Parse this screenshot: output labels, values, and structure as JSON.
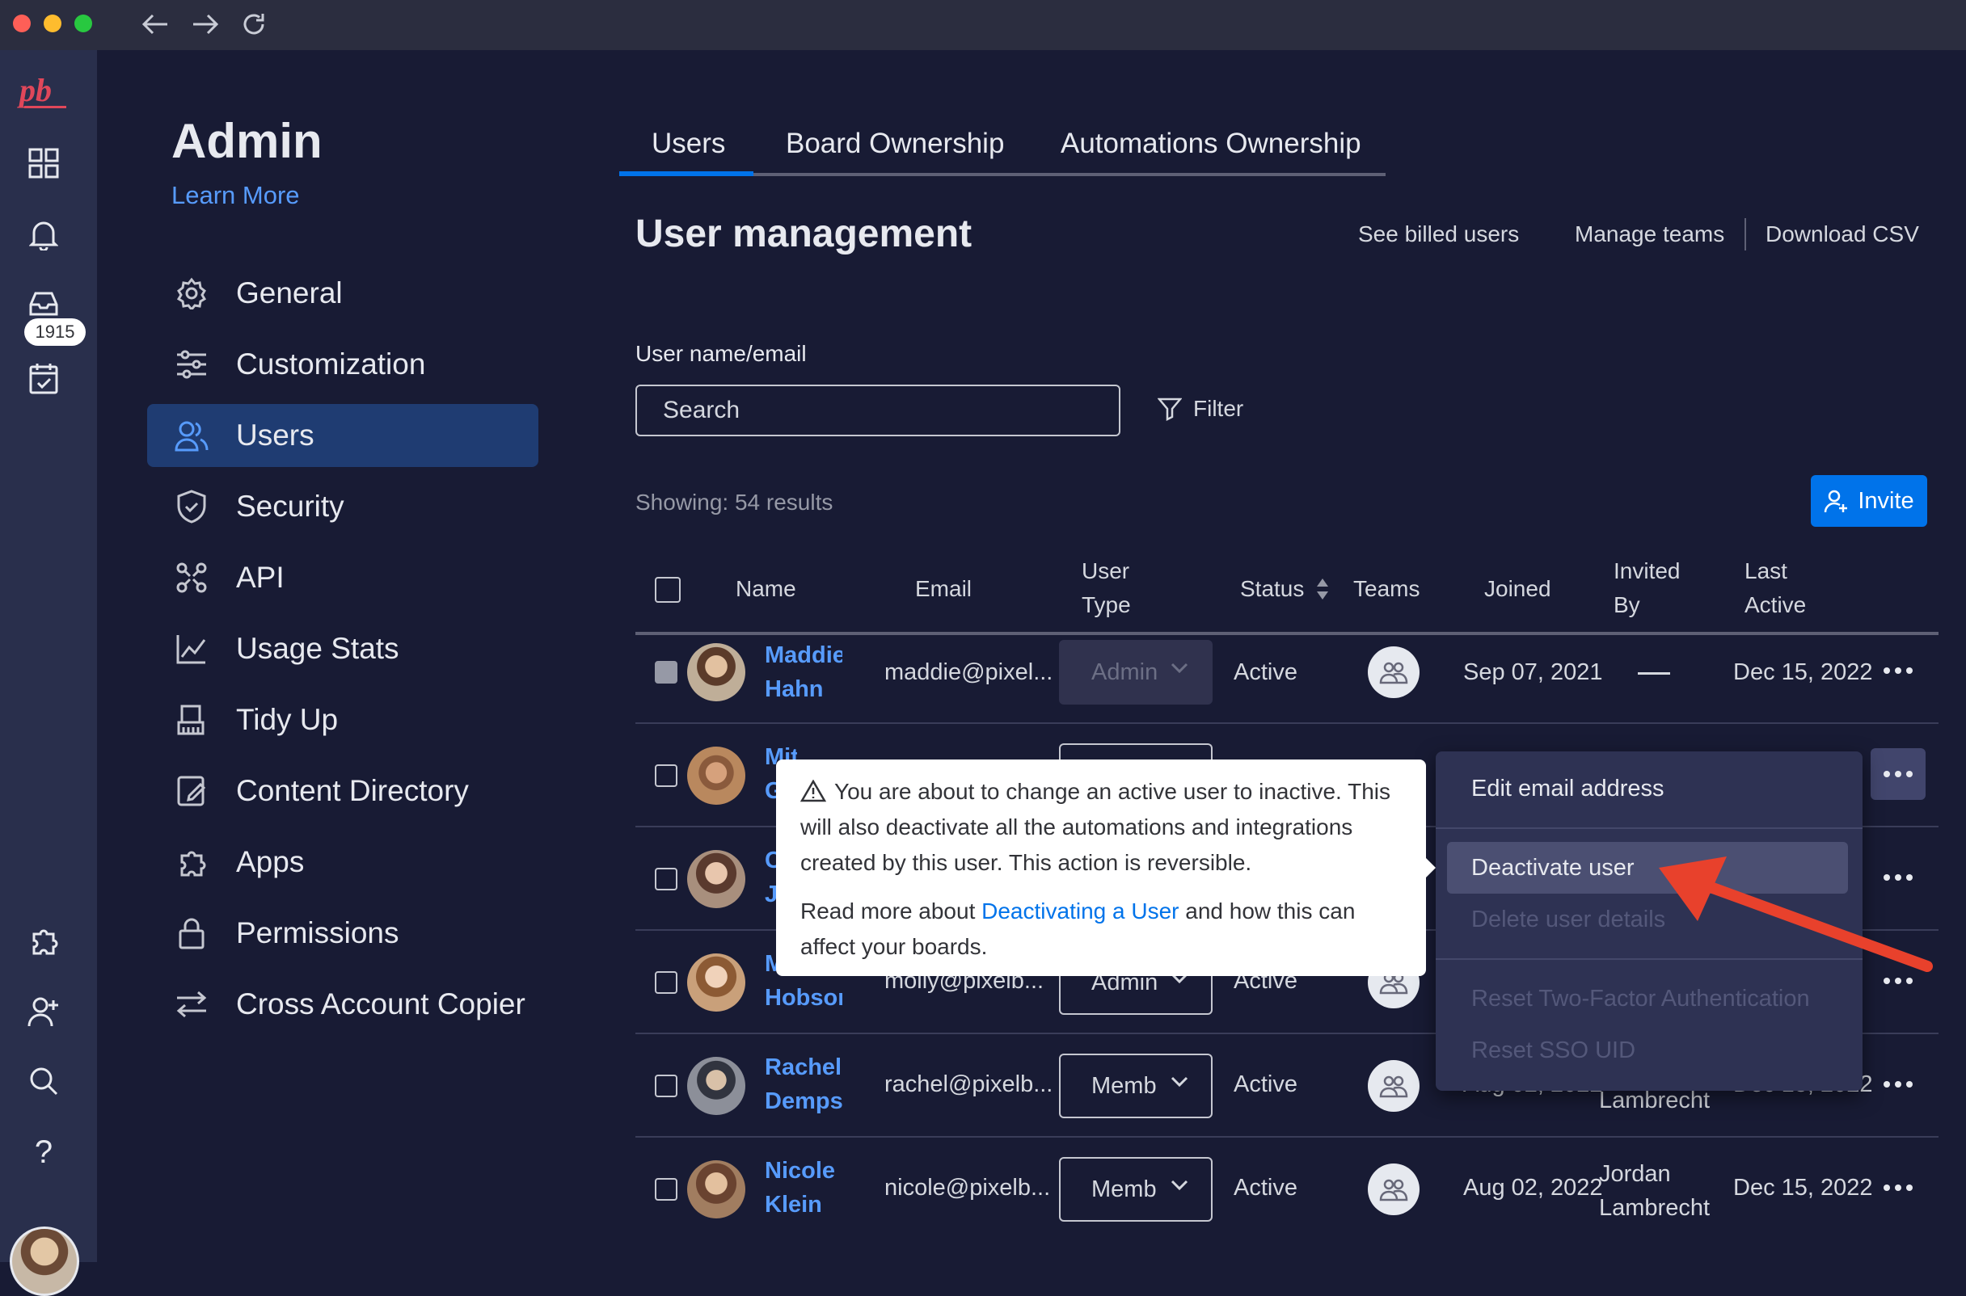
{
  "window": {
    "traffic_colors": [
      "#fe5f57",
      "#febc2e",
      "#28c840"
    ]
  },
  "rail": {
    "badge": "1915",
    "icons": [
      "logo-icon",
      "grid-icon",
      "bell-icon",
      "inbox-icon",
      "calendar-check-icon",
      "puzzle-icon",
      "add-user-icon",
      "search-icon",
      "help-icon"
    ]
  },
  "admin": {
    "title": "Admin",
    "learn_more": "Learn More",
    "menu": [
      {
        "label": "General",
        "icon": "gear-icon"
      },
      {
        "label": "Customization",
        "icon": "sliders-icon"
      },
      {
        "label": "Users",
        "icon": "users-icon",
        "active": true
      },
      {
        "label": "Security",
        "icon": "shield-icon"
      },
      {
        "label": "API",
        "icon": "api-icon"
      },
      {
        "label": "Usage Stats",
        "icon": "chart-icon"
      },
      {
        "label": "Tidy Up",
        "icon": "broom-icon"
      },
      {
        "label": "Content Directory",
        "icon": "document-icon"
      },
      {
        "label": "Apps",
        "icon": "puzzle-icon"
      },
      {
        "label": "Permissions",
        "icon": "lock-icon"
      },
      {
        "label": "Cross Account Copier",
        "icon": "swap-icon"
      }
    ]
  },
  "tabs": [
    "Users",
    "Board Ownership",
    "Automations Ownership"
  ],
  "page": {
    "title": "User management",
    "links": [
      "See billed users",
      "Manage teams",
      "Download CSV"
    ],
    "search_label": "User name/email",
    "search_placeholder": "Search",
    "filter": "Filter",
    "showing": "Showing: 54 results",
    "invite": "Invite"
  },
  "table": {
    "headers": {
      "name": "Name",
      "email": "Email",
      "user_type_1": "User",
      "user_type_2": "Type",
      "status": "Status",
      "teams": "Teams",
      "joined": "Joined",
      "invited_1": "Invited",
      "invited_2": "By",
      "last_1": "Last",
      "last_2": "Active"
    },
    "rows": [
      {
        "first": "Maddie",
        "last": "Hahn",
        "email": "maddie@pixel...",
        "type": "Admin",
        "status": "Active",
        "joined": "Sep 07, 2021",
        "invited_1": "",
        "invited_2": "",
        "last_active": "Dec 15, 2022"
      },
      {
        "first": "Mitchel",
        "last": "G",
        "email": "",
        "type": "",
        "status": "",
        "joined": "",
        "invited_1": "",
        "invited_2": "",
        "last_active": ""
      },
      {
        "first": "C",
        "last": "J",
        "email": "",
        "type": "",
        "status": "",
        "joined": "",
        "invited_1": "",
        "invited_2": "",
        "last_active": ""
      },
      {
        "first": "M",
        "last": "Hobson",
        "email": "molly@pixelb...",
        "type": "Admin",
        "status": "Active",
        "joined": "",
        "invited_1": "",
        "invited_2": "",
        "last_active": ""
      },
      {
        "first": "Rachel",
        "last": "Dempse",
        "email": "rachel@pixelb...",
        "type": "Memb",
        "status": "Active",
        "joined": "Aug 02, 2022",
        "invited_1": "",
        "invited_2": "Lambrecht",
        "last_active": "Dec 15, 2022"
      },
      {
        "first": "Nicole",
        "last": "Klein",
        "email": "nicole@pixelb...",
        "type": "Memb",
        "status": "Active",
        "joined": "Aug 02, 2022",
        "invited_1": "Jordan",
        "invited_2": "Lambrecht",
        "last_active": "Dec 15, 2022"
      }
    ]
  },
  "tooltip": {
    "line1": "You are about to change an active user to inactive. This will also deactivate all the automations and integrations created by this user. This action is reversible.",
    "read_more_pre": "Read more about ",
    "read_more_link": "Deactivating a User",
    "read_more_post": " and how this can affect your boards."
  },
  "context_menu": {
    "edit_email": "Edit email address",
    "deactivate": "Deactivate user",
    "delete_details": "Delete user details",
    "reset_2fa": "Reset Two-Factor Authentication",
    "reset_sso": "Reset SSO UID"
  },
  "colors": {
    "accent": "#0073ea",
    "link": "#579bfc",
    "annotation_arrow": "#e8412c"
  }
}
